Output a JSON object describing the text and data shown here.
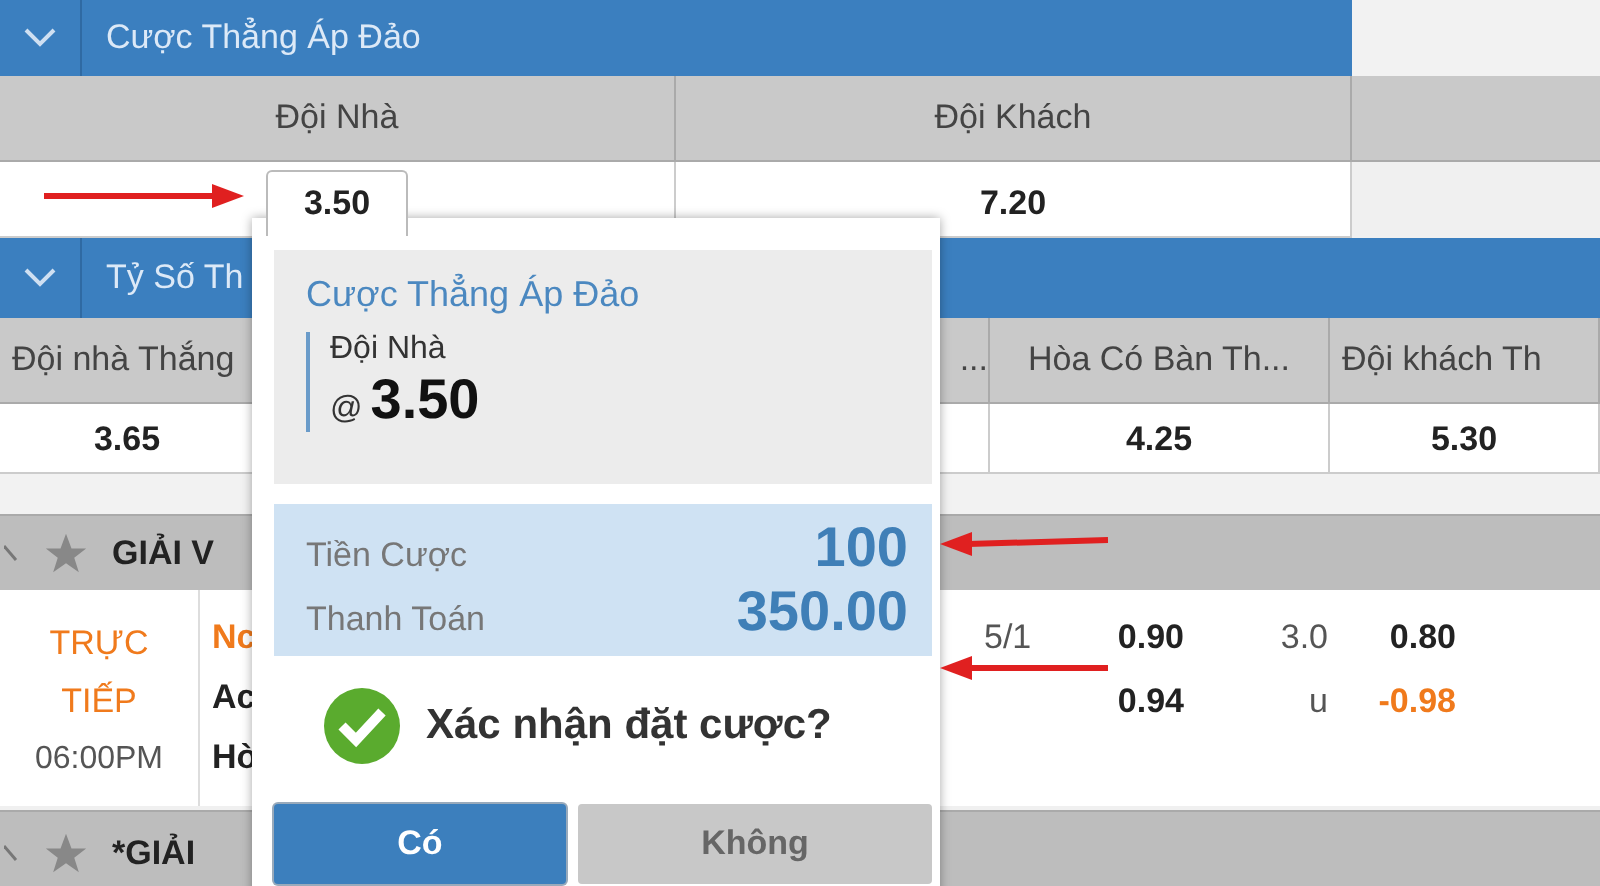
{
  "markets": [
    {
      "title": "Cược Thẳng Áp Đảo",
      "columns": [
        "Đội Nhà",
        "Đội Khách"
      ],
      "odds": [
        {
          "value": "3.50",
          "selected": true
        },
        {
          "value": "7.20",
          "selected": false
        }
      ]
    },
    {
      "title": "Tỷ Số Th",
      "columns": [
        "Đội nhà Thắng",
        "...",
        "Hòa Có Bàn Th...",
        "Đội khách Th"
      ],
      "odds": [
        "3.65",
        "4.25",
        "5.30"
      ]
    }
  ],
  "leagues": [
    {
      "title": "GIẢI V",
      "status": "TRỰC TIẾP",
      "time": "06:00PM",
      "teams": [
        {
          "name": "Nc",
          "highlight": true
        },
        {
          "name": "Ac",
          "highlight": false
        },
        {
          "name": "Hò",
          "highlight": false
        }
      ],
      "lines": [
        {
          "handicap": "5/1",
          "home": "0.90",
          "total": "3.0",
          "over": "0.80",
          "negative": false
        },
        {
          "home": "0.94",
          "total": "u",
          "over": "-0.98",
          "negative": true
        }
      ]
    },
    {
      "title": "*GIẢI"
    }
  ],
  "bet_slip": {
    "title": "Cược Thẳng Áp Đảo",
    "selection": "Đội Nhà",
    "at": "@",
    "odds": "3.50",
    "stake_label": "Tiền Cược",
    "stake": "100",
    "payout_label": "Thanh Toán",
    "payout": "350.00",
    "confirm": "Xác nhận đặt cược?",
    "buttons": [
      {
        "label": "Có",
        "selected": true
      },
      {
        "label": "Không",
        "selected": false
      }
    ]
  }
}
